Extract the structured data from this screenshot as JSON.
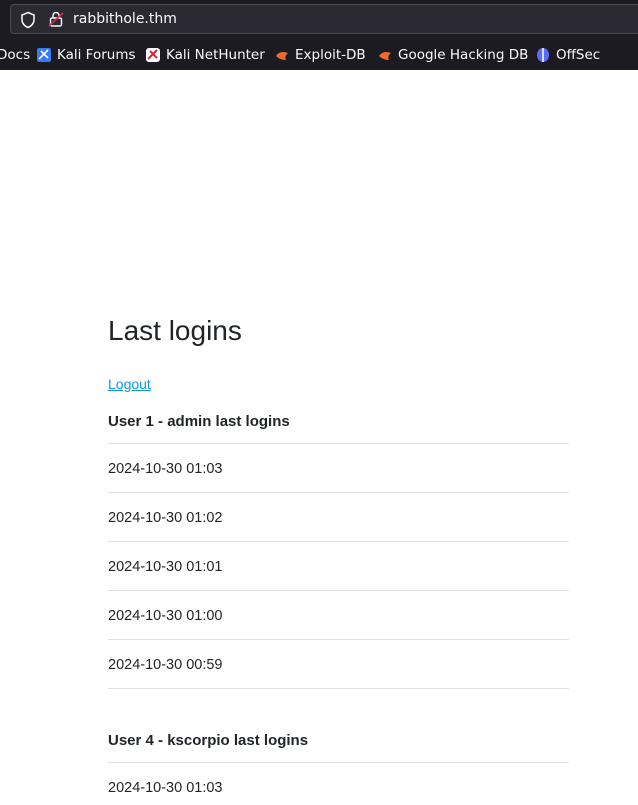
{
  "browser": {
    "url": "rabbithole.thm",
    "bookmarks": [
      {
        "label": "Docs",
        "icon": "kali-docs-icon"
      },
      {
        "label": "Kali Forums",
        "icon": "kali-forums-icon"
      },
      {
        "label": "Kali NetHunter",
        "icon": "kali-nethunter-icon"
      },
      {
        "label": "Exploit-DB",
        "icon": "exploit-db-icon"
      },
      {
        "label": "Google Hacking DB",
        "icon": "ghdb-icon"
      },
      {
        "label": "OffSec",
        "icon": "offsec-icon"
      }
    ]
  },
  "page": {
    "title": "Last logins",
    "logout_label": "Logout",
    "users": [
      {
        "heading": "User 1 - admin last logins",
        "logins": [
          "2024-10-30 01:03",
          "2024-10-30 01:02",
          "2024-10-30 01:01",
          "2024-10-30 01:00",
          "2024-10-30 00:59"
        ]
      },
      {
        "heading": "User 4 - kscorpio last logins",
        "logins": [
          "2024-10-30 01:03"
        ]
      }
    ]
  },
  "colors": {
    "chrome_bg": "#1c1b22",
    "urlbar_bg": "#2b2a33",
    "link": "#0d9bd8",
    "text": "#212529",
    "divider": "#dee2e6"
  }
}
